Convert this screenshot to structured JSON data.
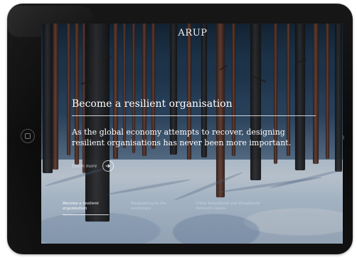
{
  "app": {
    "brand": "ARUP"
  },
  "hero": {
    "headline": "Become a resilient organisation",
    "intro": "As the global economy attempts to recover, designing resilient organisations has never been more important.",
    "learn_more": "Learn more"
  },
  "navigation": [
    {
      "label": "Become a resilient organisation",
      "active": true
    },
    {
      "label": "Responding to the workplace",
      "active": false
    },
    {
      "label": "Cities broadband and Broadband Network Issues",
      "active": false
    }
  ],
  "icons": {
    "home_button": "home-button-icon",
    "learn_more_arrow": "arrow-right-icon"
  },
  "colors": {
    "bezel": "#111111",
    "sky": "#243e57",
    "snow": "#dfe9f3",
    "text": "#ffffff"
  }
}
